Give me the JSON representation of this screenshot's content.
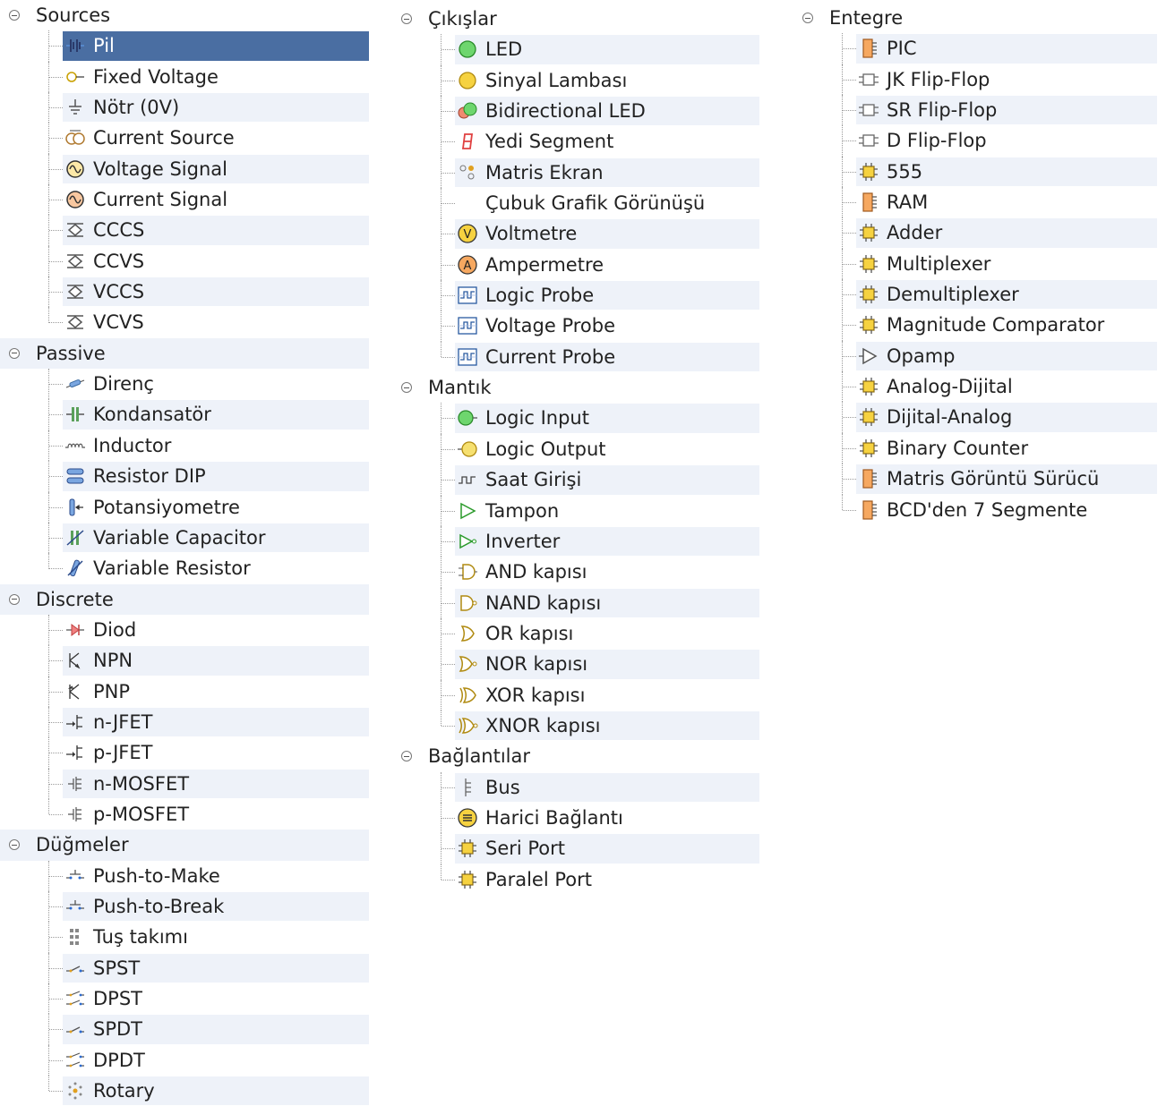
{
  "columns": [
    {
      "categories": [
        {
          "label": "Sources",
          "items": [
            {
              "label": "Pil",
              "icon": "battery-icon",
              "selected": true
            },
            {
              "label": "Fixed Voltage",
              "icon": "fixed-voltage-icon"
            },
            {
              "label": "Nötr (0V)",
              "icon": "ground-icon"
            },
            {
              "label": "Current Source",
              "icon": "current-source-icon"
            },
            {
              "label": "Voltage Signal",
              "icon": "voltage-signal-icon"
            },
            {
              "label": "Current Signal",
              "icon": "current-signal-icon"
            },
            {
              "label": "CCCS",
              "icon": "dependent-source-icon"
            },
            {
              "label": "CCVS",
              "icon": "dependent-source-icon"
            },
            {
              "label": "VCCS",
              "icon": "dependent-source-icon"
            },
            {
              "label": "VCVS",
              "icon": "dependent-source-icon"
            }
          ]
        },
        {
          "label": "Passive",
          "items": [
            {
              "label": "Direnç",
              "icon": "resistor-icon"
            },
            {
              "label": "Kondansatör",
              "icon": "capacitor-icon"
            },
            {
              "label": "Inductor",
              "icon": "inductor-icon"
            },
            {
              "label": "Resistor DIP",
              "icon": "resistor-dip-icon"
            },
            {
              "label": "Potansiyometre",
              "icon": "potentiometer-icon"
            },
            {
              "label": "Variable Capacitor",
              "icon": "variable-capacitor-icon"
            },
            {
              "label": "Variable Resistor",
              "icon": "variable-resistor-icon"
            }
          ]
        },
        {
          "label": "Discrete",
          "items": [
            {
              "label": "Diod",
              "icon": "diode-icon"
            },
            {
              "label": "NPN",
              "icon": "npn-transistor-icon"
            },
            {
              "label": "PNP",
              "icon": "pnp-transistor-icon"
            },
            {
              "label": "n-JFET",
              "icon": "jfet-icon"
            },
            {
              "label": "p-JFET",
              "icon": "jfet-icon"
            },
            {
              "label": "n-MOSFET",
              "icon": "mosfet-icon"
            },
            {
              "label": "p-MOSFET",
              "icon": "mosfet-icon"
            }
          ]
        },
        {
          "label": "Düğmeler",
          "items": [
            {
              "label": "Push-to-Make",
              "icon": "push-switch-icon"
            },
            {
              "label": "Push-to-Break",
              "icon": "push-switch-icon"
            },
            {
              "label": "Tuş takımı",
              "icon": "keypad-icon"
            },
            {
              "label": "SPST",
              "icon": "switch-icon"
            },
            {
              "label": "DPST",
              "icon": "double-switch-icon"
            },
            {
              "label": "SPDT",
              "icon": "switch-icon"
            },
            {
              "label": "DPDT",
              "icon": "double-switch-icon"
            },
            {
              "label": "Rotary",
              "icon": "rotary-switch-icon"
            }
          ]
        }
      ]
    },
    {
      "categories": [
        {
          "label": "Çıkışlar",
          "items": [
            {
              "label": "LED",
              "icon": "led-icon"
            },
            {
              "label": "Sinyal Lambası",
              "icon": "signal-lamp-icon"
            },
            {
              "label": "Bidirectional LED",
              "icon": "bidirectional-led-icon"
            },
            {
              "label": "Yedi Segment",
              "icon": "seven-segment-icon"
            },
            {
              "label": "Matris Ekran",
              "icon": "matrix-display-icon"
            },
            {
              "label": "Çubuk Grafik Görünüşü",
              "icon": "none"
            },
            {
              "label": "Voltmetre",
              "icon": "voltmeter-icon"
            },
            {
              "label": "Ampermetre",
              "icon": "ammeter-icon"
            },
            {
              "label": "Logic Probe",
              "icon": "probe-icon"
            },
            {
              "label": "Voltage Probe",
              "icon": "probe-icon"
            },
            {
              "label": "Current Probe",
              "icon": "probe-icon"
            }
          ]
        },
        {
          "label": "Mantık",
          "items": [
            {
              "label": "Logic Input",
              "icon": "logic-input-icon"
            },
            {
              "label": "Logic Output",
              "icon": "logic-output-icon"
            },
            {
              "label": "Saat Girişi",
              "icon": "clock-icon"
            },
            {
              "label": "Tampon",
              "icon": "buffer-gate-icon"
            },
            {
              "label": "Inverter",
              "icon": "inverter-gate-icon"
            },
            {
              "label": "AND kapısı",
              "icon": "and-gate-icon"
            },
            {
              "label": "NAND kapısı",
              "icon": "nand-gate-icon"
            },
            {
              "label": "OR kapısı",
              "icon": "or-gate-icon"
            },
            {
              "label": "NOR kapısı",
              "icon": "nor-gate-icon"
            },
            {
              "label": "XOR kapısı",
              "icon": "xor-gate-icon"
            },
            {
              "label": "XNOR kapısı",
              "icon": "xnor-gate-icon"
            }
          ]
        },
        {
          "label": "Bağlantılar",
          "items": [
            {
              "label": "Bus",
              "icon": "bus-icon"
            },
            {
              "label": "Harici Bağlantı",
              "icon": "external-connection-icon"
            },
            {
              "label": "Seri Port",
              "icon": "chip-icon"
            },
            {
              "label": "Paralel Port",
              "icon": "chip-icon"
            }
          ]
        }
      ]
    },
    {
      "categories": [
        {
          "label": "Entegre",
          "items": [
            {
              "label": "PIC",
              "icon": "dip-chip-icon"
            },
            {
              "label": "JK Flip-Flop",
              "icon": "flip-flop-icon"
            },
            {
              "label": "SR Flip-Flop",
              "icon": "flip-flop-icon"
            },
            {
              "label": "D Flip-Flop",
              "icon": "flip-flop-icon"
            },
            {
              "label": "555",
              "icon": "chip-icon"
            },
            {
              "label": "RAM",
              "icon": "dip-chip-icon"
            },
            {
              "label": "Adder",
              "icon": "chip-icon"
            },
            {
              "label": "Multiplexer",
              "icon": "chip-icon"
            },
            {
              "label": "Demultiplexer",
              "icon": "chip-icon"
            },
            {
              "label": "Magnitude Comparator",
              "icon": "chip-icon"
            },
            {
              "label": "Opamp",
              "icon": "opamp-icon"
            },
            {
              "label": "Analog-Dijital",
              "icon": "chip-icon"
            },
            {
              "label": "Dijital-Analog",
              "icon": "chip-icon"
            },
            {
              "label": "Binary Counter",
              "icon": "chip-icon"
            },
            {
              "label": "Matris Görüntü Sürücü",
              "icon": "dip-chip-icon"
            },
            {
              "label": "BCD'den 7 Segmente",
              "icon": "dip-chip-icon"
            }
          ]
        }
      ]
    }
  ]
}
